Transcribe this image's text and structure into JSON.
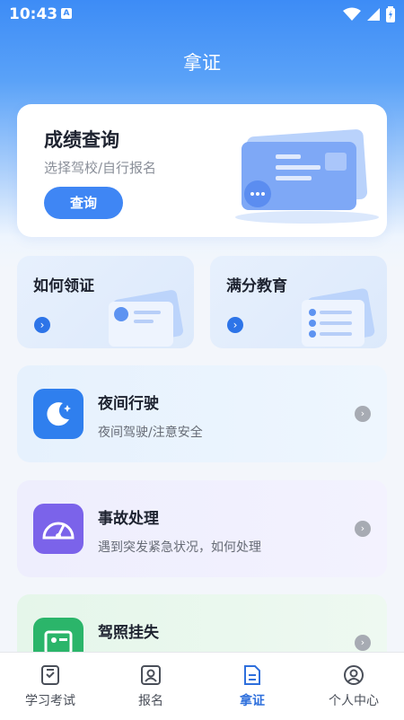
{
  "status_bar": {
    "time": "10:43",
    "notif_badge": "A"
  },
  "header": {
    "title": "拿证"
  },
  "score_card": {
    "title": "成绩查询",
    "subtitle": "选择驾校/自行报名",
    "button": "查询"
  },
  "quick_cards": [
    {
      "label": "如何领证"
    },
    {
      "label": "满分教育"
    }
  ],
  "list": [
    {
      "title": "夜间行驶",
      "desc": "夜间驾驶/注意安全",
      "icon": "moon-icon"
    },
    {
      "title": "事故处理",
      "desc": "遇到突发紧急状况，如何处理",
      "icon": "gauge-icon"
    },
    {
      "title": "驾照挂失",
      "desc": "",
      "icon": "license-icon"
    }
  ],
  "tabs": [
    {
      "label": "学习考试",
      "icon": "study-icon"
    },
    {
      "label": "报名",
      "icon": "enroll-icon"
    },
    {
      "label": "拿证",
      "icon": "certificate-icon",
      "active": true
    },
    {
      "label": "个人中心",
      "icon": "profile-icon"
    }
  ],
  "colors": {
    "accent": "#3f86f4",
    "tab_active": "#2e6fdc"
  }
}
